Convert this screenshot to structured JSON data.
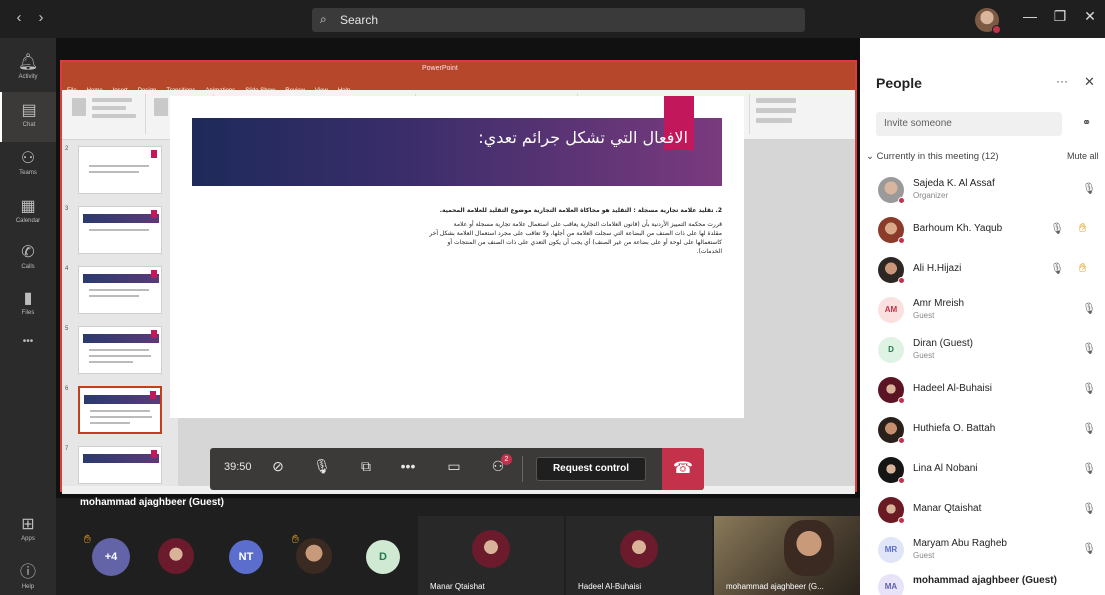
{
  "app": {
    "search_placeholder": "Search"
  },
  "nav": {
    "back": "‹",
    "forward": "›"
  },
  "window_controls": {
    "minimize": "—",
    "restore": "❐",
    "close": "✕"
  },
  "rail": [
    {
      "label": "Activity",
      "icon": "bell-icon",
      "glyph": "🔔"
    },
    {
      "label": "Chat",
      "icon": "chat-icon",
      "glyph": "💬"
    },
    {
      "label": "Teams",
      "icon": "teams-icon",
      "glyph": "👥"
    },
    {
      "label": "Calendar",
      "icon": "calendar-icon",
      "glyph": "📅"
    },
    {
      "label": "Calls",
      "icon": "phone-icon",
      "glyph": "📞"
    },
    {
      "label": "Files",
      "icon": "file-icon",
      "glyph": "📄"
    },
    {
      "label": "•••",
      "icon": "more-icon",
      "glyph": ""
    },
    {
      "label": "Apps",
      "icon": "apps-icon",
      "glyph": "⊞"
    },
    {
      "label": "Help",
      "icon": "help-icon",
      "glyph": "?"
    }
  ],
  "shared_screen": {
    "slide_title": "الافعال التي تشكل جرائم تعدي:",
    "slide_point": "2. تقليد علامة تجارية مسجلة : التقليد هو محاكاة العلامة التجارية موضوع التقليد للعلامة المحمية.",
    "slide_body_1": "قررت محكمة التمييز الأردنية بأن (قانون العلامات التجارية يعاقب على استعمال علامة تجارية مسجلة أو علامة",
    "slide_body_2": "مقلدة لها على ذات الصنف من البضاعة التي سجلت العلامة من أجلها، ولا تعاقب على مجرد استعمال العلامة بشكل آخر",
    "slide_body_3": "كاستعمالها على لوحة أو على بضاعة من غير الصنف) أي يجب أن يكون التعدي على ذات الصنف من المنتجات أو",
    "slide_body_4": "الخدمات)."
  },
  "controls": {
    "timer": "39:50",
    "participants_badge": "2",
    "request_control": "Request control"
  },
  "presenter_label": "mohammad ajaghbeer (Guest)",
  "gallery": {
    "overflow_count": "+4",
    "tiles": [
      {
        "initials": "NT"
      },
      {
        "initials": "D"
      },
      {
        "name": "Manar Qtaishat"
      },
      {
        "name": "Hadeel Al-Buhaisi"
      },
      {
        "name": "mohammad ajaghbeer (G..."
      }
    ]
  },
  "people": {
    "title": "People",
    "invite_placeholder": "Invite someone",
    "section": "Currently in this meeting (12)",
    "mute_all": "Mute all",
    "list": [
      {
        "name": "Sajeda K. Al Assaf",
        "sub": "Organizer",
        "initials": ""
      },
      {
        "name": "Barhoum Kh. Yaqub",
        "sub": "",
        "initials": ""
      },
      {
        "name": "Ali H.Hijazi",
        "sub": "",
        "initials": ""
      },
      {
        "name": "Amr Mreish",
        "sub": "Guest",
        "initials": "AM"
      },
      {
        "name": "Diran (Guest)",
        "sub": "Guest",
        "initials": "D"
      },
      {
        "name": "Hadeel Al-Buhaisi",
        "sub": "",
        "initials": ""
      },
      {
        "name": "Huthiefa O. Battah",
        "sub": "",
        "initials": ""
      },
      {
        "name": "Lina Al Nobani",
        "sub": "",
        "initials": ""
      },
      {
        "name": "Manar Qtaishat",
        "sub": "",
        "initials": ""
      },
      {
        "name": "Maryam Abu Ragheb",
        "sub": "Guest",
        "initials": "MR"
      },
      {
        "name": "mohammad ajaghbeer (Guest)",
        "sub": "",
        "initials": "MA"
      }
    ]
  },
  "colors": {
    "accent": "#6264a7",
    "hangup": "#c4314b",
    "ppt": "#b7472a"
  }
}
